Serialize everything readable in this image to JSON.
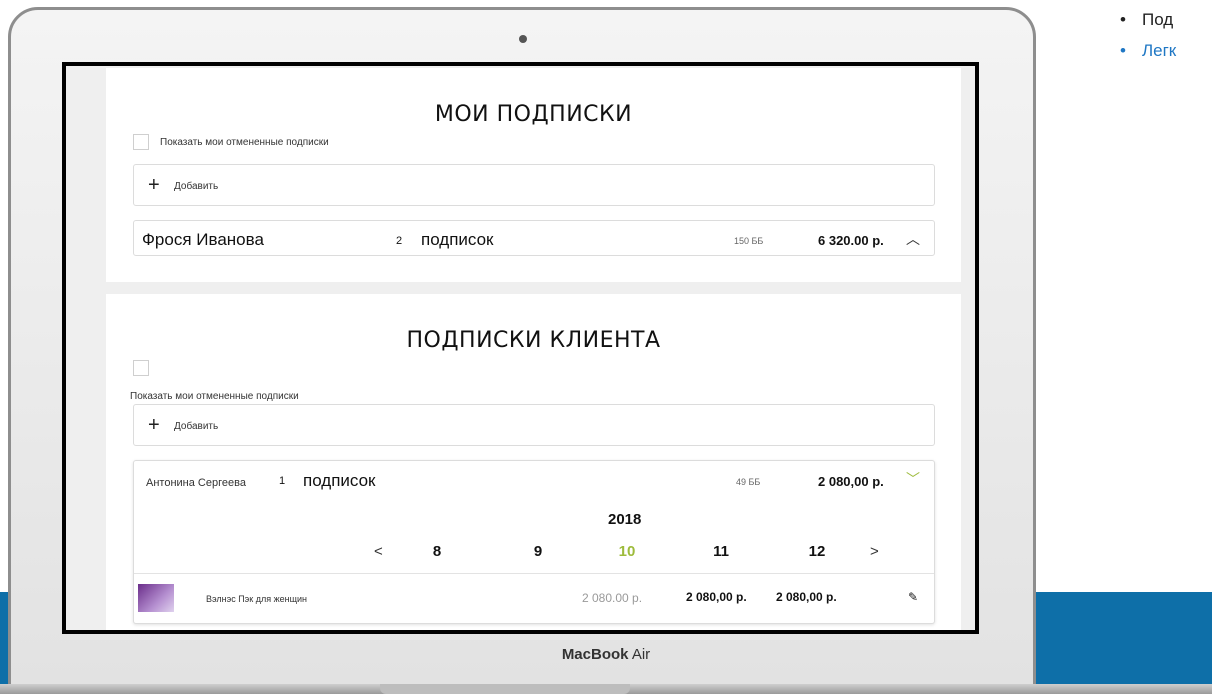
{
  "background": {
    "bullets": [
      "Под",
      "Легк"
    ],
    "band_color": "#0e6fa8"
  },
  "laptop": {
    "brand_bold": "MacBook",
    "brand_thin": " Air"
  },
  "my_subscriptions": {
    "title": "МОИ ПОДПИСКИ",
    "show_canceled_label": "Показать мои отмененные подписки",
    "add_label": "Добавить",
    "subscriber": {
      "name": "Фрося Иванова",
      "count": "2",
      "count_label": "подписок",
      "points": "150 ББ",
      "total": "6 320.00 р.",
      "expanded": true
    }
  },
  "client_subscriptions": {
    "title": "ПОДПИСКИ КЛИЕНТА",
    "show_canceled_label": "Показать мои отмененные подписки",
    "add_label": "Добавить",
    "subscriber": {
      "name": "Антонина Сергеева",
      "count": "1",
      "count_label": "подписок",
      "points": "49 ББ",
      "total": "2 080,00 р.",
      "expanded": false
    },
    "calendar": {
      "year": "2018",
      "months": [
        "8",
        "9",
        "10",
        "11",
        "12"
      ],
      "active_month": "10",
      "prev_icon": "chevron-left-icon",
      "next_icon": "chevron-right-icon"
    },
    "items": [
      {
        "name": "Вэлнэс Пэк для женщин",
        "price_old": "2 080.00 р.",
        "price_1": "2 080,00 р.",
        "price_2": "2 080,00 р.",
        "thumb_icon": "product-box-icon",
        "edit_icon": "pencil-icon"
      }
    ]
  },
  "colors": {
    "accent_green": "#9dbb3b"
  }
}
